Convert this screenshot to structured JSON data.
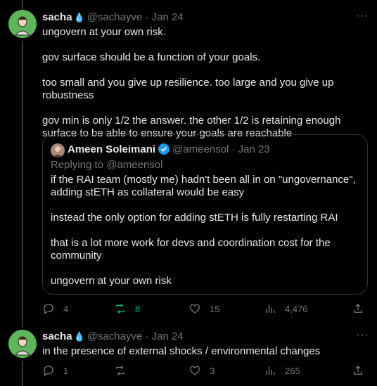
{
  "tweet1": {
    "name": "sacha",
    "handle": "@sachayve",
    "sep": "·",
    "date": "Jan 24",
    "more": "···",
    "paragraphs": [
      "ungovern at your own risk.",
      "gov surface should be a function of your goals.",
      "too small and you give up resilience. too large and you give up robustness",
      "gov min is only 1/2 the answer. the other 1/2 is retaining enough surface to be able to ensure your goals are reachable"
    ],
    "quote": {
      "name": "Ameen Soleimani",
      "handle": "@ameensol",
      "sep": "·",
      "date": "Jan 23",
      "replying_to": "Replying to @ameensol",
      "paragraphs": [
        "if the RAI team (mostly me) hadn't been all in on \"ungovernance\", adding stETH as collateral would be easy",
        "instead the only option for adding stETH is fully restarting RAI",
        "that is a lot more work for devs and coordination cost for the community",
        "ungovern at your own risk"
      ]
    },
    "actions": {
      "replies": "4",
      "reposts": "8",
      "likes": "15",
      "views": "4,476"
    }
  },
  "tweet2": {
    "name": "sacha",
    "handle": "@sachayve",
    "sep": "·",
    "date": "Jan 24",
    "more": "···",
    "text": "in the presence of external shocks / environmental changes",
    "actions": {
      "replies": "1",
      "reposts": "",
      "likes": "3",
      "views": "265"
    }
  },
  "colors": {
    "background": "#000000",
    "text": "#e7e9ea",
    "muted": "#71767b",
    "accent": "#1d9bf0",
    "repost_active": "#00ba7c"
  }
}
